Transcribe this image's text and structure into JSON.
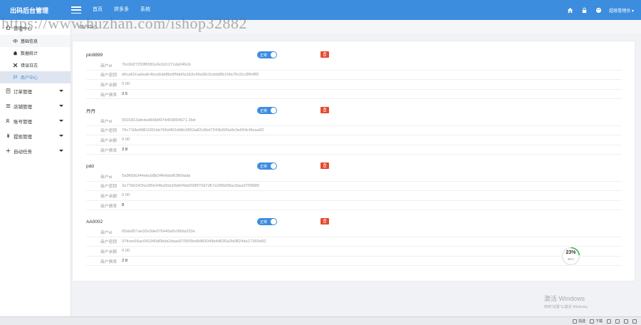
{
  "header": {
    "brand": "出码后台管理",
    "nav": [
      "首页",
      "拼多多",
      "系统"
    ],
    "user": "超级管理员"
  },
  "watermark": "https://www.huzhan.com/ishop32882",
  "tabstrip": {
    "label": "商户中心"
  },
  "sidebar": {
    "groups": [
      {
        "label": "管理中心",
        "icon": "home-icon"
      },
      {
        "label": "订单管理",
        "icon": "list-icon"
      },
      {
        "label": "店铺管理",
        "icon": "store-icon"
      },
      {
        "label": "账号管理",
        "icon": "user-icon"
      },
      {
        "label": "提现管理",
        "icon": "money-icon"
      },
      {
        "label": "自动任务",
        "icon": "task-icon"
      }
    ],
    "subitems": [
      {
        "label": "基础信息",
        "icon": "eye-icon"
      },
      {
        "label": "数据统计",
        "icon": "home-icon"
      },
      {
        "label": "错误日志",
        "icon": "x-icon"
      },
      {
        "label": "商户中心",
        "icon": "flag-icon"
      }
    ]
  },
  "field_labels": {
    "id": "商户id",
    "secret": "商户密钥",
    "balance": "商户余额",
    "rate": "商户费率"
  },
  "status_label": "正常",
  "merchants": [
    {
      "name": "pin8899",
      "id": "7bc8d27259f6581e6cb2c27cda046cb",
      "secret": "d6ca62cadeafc4bca6ab8fa9f5bb0a1b3c49a36c5cddd0b10fa76c91c8f64ff9",
      "balance": "0.00",
      "rate": "2.5"
    },
    {
      "name": "丹丹",
      "id": "5501813afebed66b8974409804671 2bd",
      "secret": "76c716bd5f8116f1bb766d452d48c0853a82c6bd7243b600a9c0e664cf9eaa00",
      "balance": "0.00",
      "rate": "2.8"
    },
    {
      "name": "pdd",
      "id": "5a9fd9b344ebcb8b34fe6daf63fb9ada",
      "secret": "3e77b6342fa185b34fed3dcb5d6f4dd26f6f70d7d57a395bf3ba1bea97f068f0",
      "balance": "0.00",
      "rate": "8"
    },
    {
      "name": "AA0002",
      "id": "05da957ae32e3de076445e5c08da233e",
      "secret": "37fcee56ac041940d0bda2daad2785f3ed9483049d4d630a2b0824da17360e82",
      "balance": "0.00",
      "rate": "2.8"
    }
  ],
  "badge": {
    "percent": "23%",
    "temp": "49°C",
    "level": 0.23
  },
  "activation": {
    "title": "激活 Windows",
    "sub": "转到\"设置\"以激活 Windows。"
  },
  "taskbar": [
    "拍选",
    "下载"
  ],
  "colors": {
    "primary": "#3c8dde",
    "danger": "#e64a31",
    "badge": "#2fb55a"
  }
}
